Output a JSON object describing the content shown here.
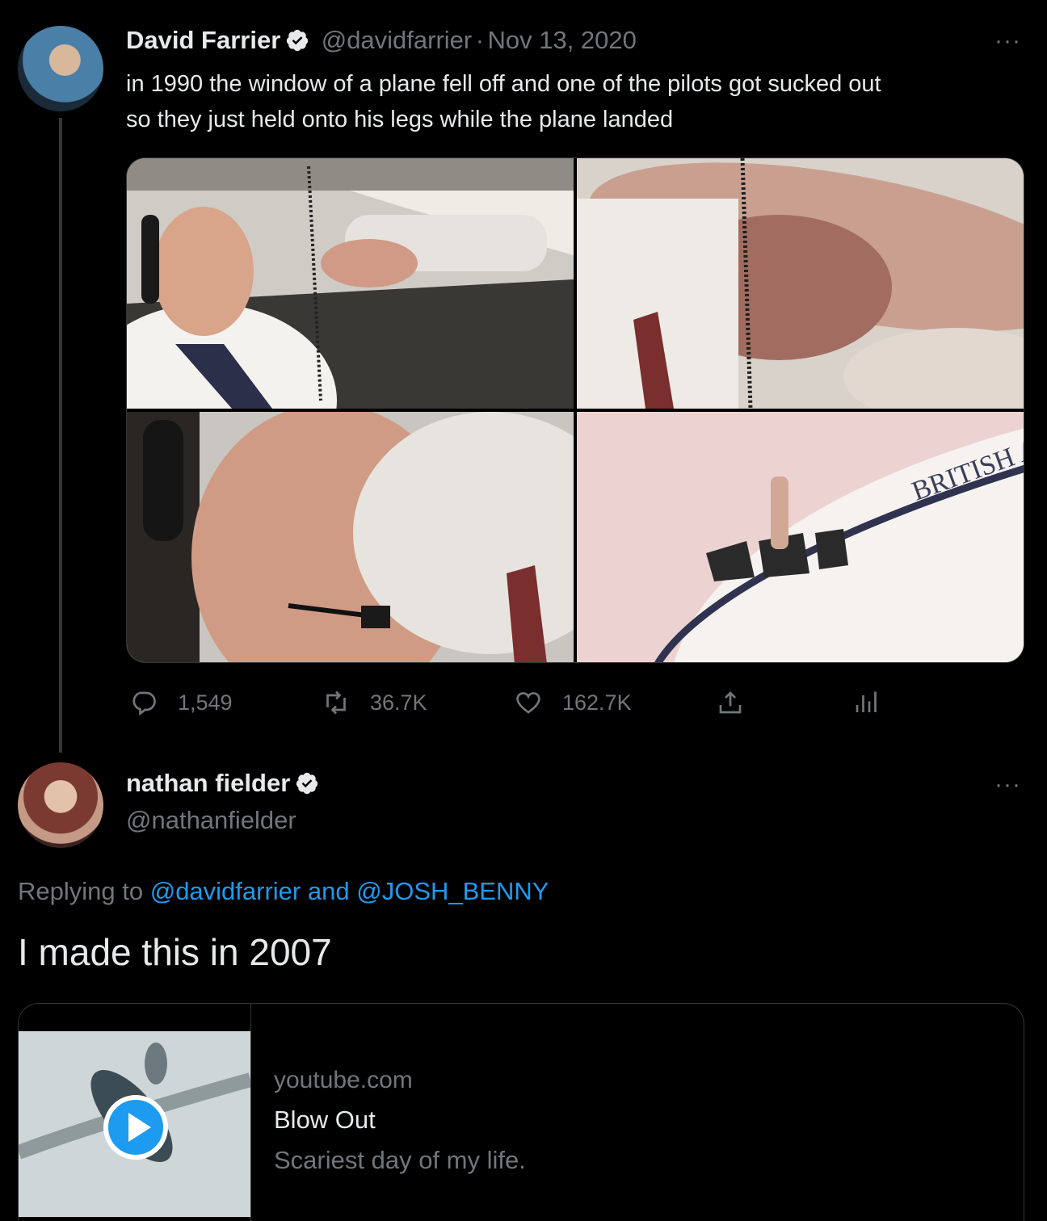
{
  "tweet1": {
    "name": "David Farrier",
    "handle": "@davidfarrier",
    "dot": "·",
    "date": "Nov 13, 2020",
    "text_line1": "in 1990 the window of a plane fell off and one of the pilots got sucked out",
    "text_line2": "so they just held onto his legs while the plane landed",
    "more": "···",
    "photo_caption": "BRITISH A",
    "stats": {
      "replies": "1,549",
      "retweets": "36.7K",
      "likes": "162.7K"
    }
  },
  "tweet2": {
    "name": "nathan fielder",
    "handle": "@nathanfielder",
    "more": "···",
    "replying_prefix": "Replying to",
    "replying_user1": "@davidfarrier",
    "replying_and": "and",
    "replying_user2": "@JOSH_BENNY",
    "text": "I made this in 2007",
    "card": {
      "domain": "youtube.com",
      "title": "Blow Out",
      "description": "Scariest day of my life."
    }
  },
  "colors": {
    "background": "#000000",
    "text": "#e7e9ea",
    "muted": "#71767b",
    "link": "#1d9bf0",
    "border": "#333639"
  },
  "icons": [
    "verified-badge-icon",
    "reply-icon",
    "retweet-icon",
    "like-icon",
    "share-icon",
    "analytics-icon",
    "more-icon",
    "play-icon"
  ]
}
